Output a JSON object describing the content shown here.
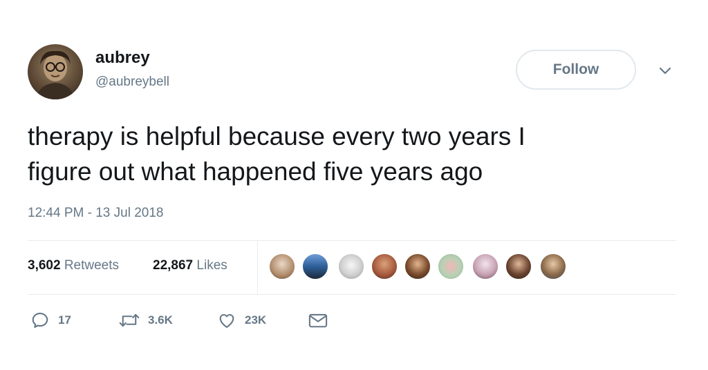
{
  "tweet": {
    "display_name": "aubrey",
    "handle": "@aubreybell",
    "follow_label": "Follow",
    "text": "therapy is helpful because every two years I\nfigure out what happened five years ago",
    "timestamp": "12:44 PM - 13 Jul 2018"
  },
  "stats": {
    "retweets_count": "3,602",
    "retweets_label": "Retweets",
    "likes_count": "22,867",
    "likes_label": "Likes"
  },
  "actions": {
    "reply_count": "17",
    "retweet_count": "3.6K",
    "like_count": "23K"
  },
  "colors": {
    "text": "#14171a",
    "secondary": "#657786",
    "border": "#e6ecf0"
  }
}
